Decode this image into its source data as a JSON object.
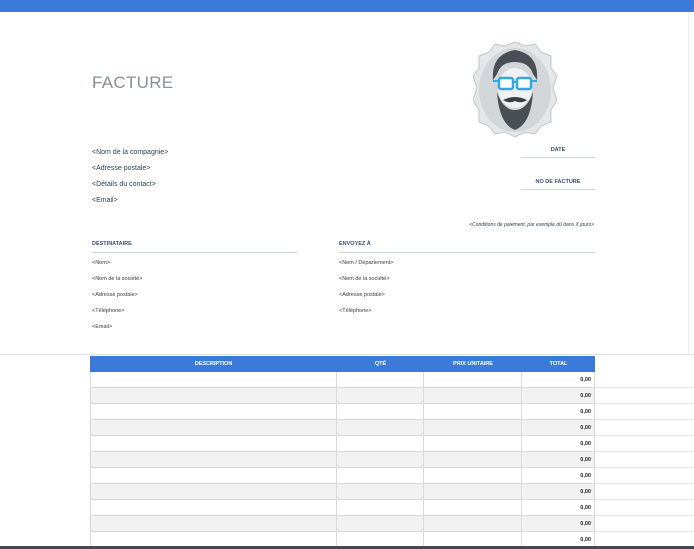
{
  "document": {
    "title": "FACTURE",
    "company": [
      "<Nom de la compagnie>",
      "<Adresse postale>",
      "<Détails du contact>",
      "<Email>"
    ],
    "date_label": "DATE",
    "invoice_number_label": "NO DE FACTURE",
    "conditions": "<Conditions de paiement, par exemple dû dans X jours>",
    "recipient": {
      "heading": "DESTINATAIRE",
      "lines": [
        "<Nom>",
        "<Nom de la société>",
        "<Adresse postale>",
        "<Téléphone>",
        "<Email>"
      ]
    },
    "sent_to": {
      "heading": "ENVOYEZ À",
      "lines": [
        "<Nom / Département>",
        "<Nom de la société>",
        "<Adresse postale>",
        "<Téléphone>"
      ]
    },
    "table": {
      "columns": [
        "DESCRIPTION",
        "QTÉ",
        "PRIX UNITAIRE",
        "TOTAL"
      ],
      "totals": [
        "0,00",
        "0,00",
        "0,00",
        "0,00",
        "0,00",
        "0,00",
        "0,00",
        "0,00",
        "0,00",
        "0,00",
        "0,00"
      ]
    }
  },
  "colors": {
    "accent": "#3c7ad9",
    "heading": "#3a4f73"
  },
  "icons": {
    "logo": "bearded-man-with-glasses-logo"
  }
}
